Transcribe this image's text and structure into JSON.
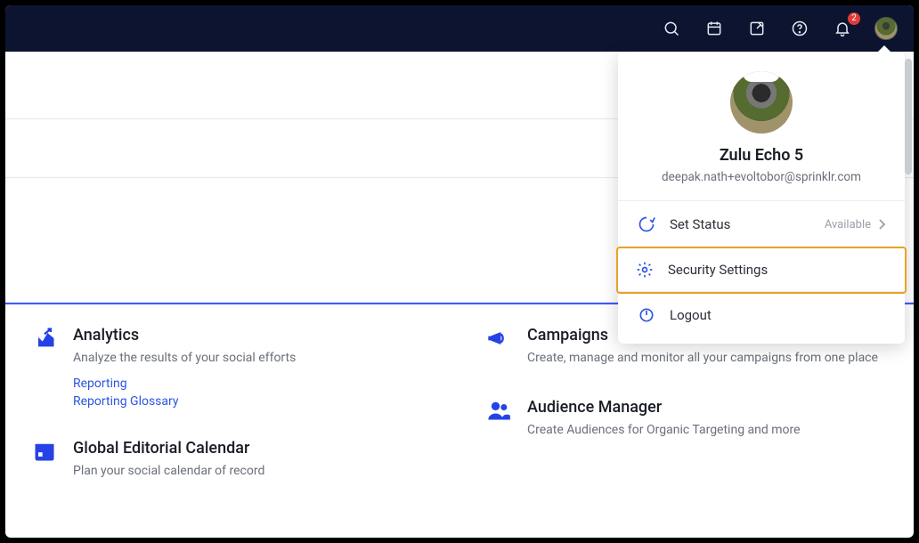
{
  "topnav": {
    "notification_count": "2"
  },
  "profile": {
    "name": "Zulu Echo 5",
    "email": "deepak.nath+evoltobor@sprinklr.com"
  },
  "menu": {
    "set_status": {
      "label": "Set Status",
      "value": "Available"
    },
    "security": {
      "label": "Security Settings"
    },
    "logout": {
      "label": "Logout"
    }
  },
  "cards": {
    "analytics": {
      "title": "Analytics",
      "sub": "Analyze the results of your social efforts",
      "links": [
        "Reporting",
        "Reporting Glossary"
      ]
    },
    "calendar": {
      "title": "Global Editorial Calendar",
      "sub": "Plan your social calendar of record"
    },
    "campaigns": {
      "title": "Campaigns",
      "sub": "Create, manage and monitor all your campaigns from one place"
    },
    "audience": {
      "title": "Audience Manager",
      "sub": "Create Audiences for Organic Targeting and more"
    }
  }
}
